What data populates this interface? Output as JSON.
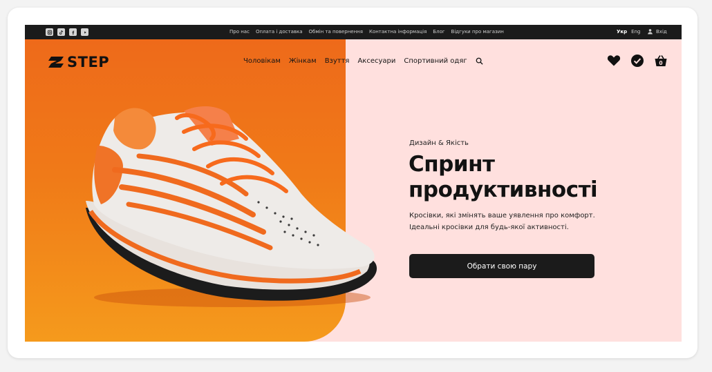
{
  "topbar": {
    "social_icons": [
      "instagram-icon",
      "tiktok-icon",
      "facebook-icon",
      "youtube-icon"
    ],
    "links": [
      "Про нас",
      "Оплата і доставка",
      "Обмін та повернення",
      "Контактна інформація",
      "Блог",
      "Відгуки про магазин"
    ],
    "lang_active": "Укр",
    "lang_other": "Eng",
    "login_label": "Вхід"
  },
  "logo_text": "STEP",
  "nav": {
    "items": [
      "Чоловікам",
      "Жінкам",
      "Взуття",
      "Аксесуари",
      "Спортивний одяг"
    ],
    "search_icon": "search-icon"
  },
  "header_icons": [
    "heart-icon",
    "check-circle-icon",
    "cart-icon"
  ],
  "cart_count": "0",
  "hero": {
    "subtitle": "Дизайн & Якість",
    "title_line1": "Спринт",
    "title_line2": "продуктивності",
    "desc_line1": "Кросівки, які змінять ваше уявлення про комфорт.",
    "desc_line2": "Ідеальні кросівки для будь-якої активності.",
    "cta": "Обрати свою пару"
  },
  "colors": {
    "accent_orange": "#ee6a1a",
    "hero_pink": "#ffe0de",
    "dark": "#1b1b1b"
  }
}
